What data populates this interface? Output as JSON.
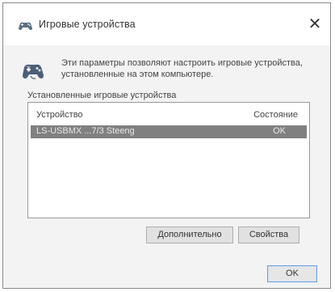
{
  "window": {
    "title": "Игровые устройства",
    "close_symbol": "✕"
  },
  "icons": {
    "title_icon": "gamepad-icon",
    "intro_icon": "gamepad-icon",
    "close_icon": "close-icon"
  },
  "intro": {
    "text": "Эти параметры позволяют настроить игровые устройства, установленные на этом компьютере."
  },
  "devices": {
    "group_label": "Установленные игровые устройства",
    "columns": {
      "device": "Устройство",
      "status": "Состояние"
    },
    "rows": [
      {
        "device": "LS-USBMX   ...7/3 Steeng",
        "status": "OK",
        "selected": true
      }
    ]
  },
  "buttons": {
    "advanced": "Дополнительно",
    "properties": "Свойства",
    "ok": "OK"
  },
  "colors": {
    "selection": "#808080",
    "selected_text": "#e8e8e8",
    "window_bg": "#f3f3f3",
    "ok_border": "#6f9fd6"
  }
}
